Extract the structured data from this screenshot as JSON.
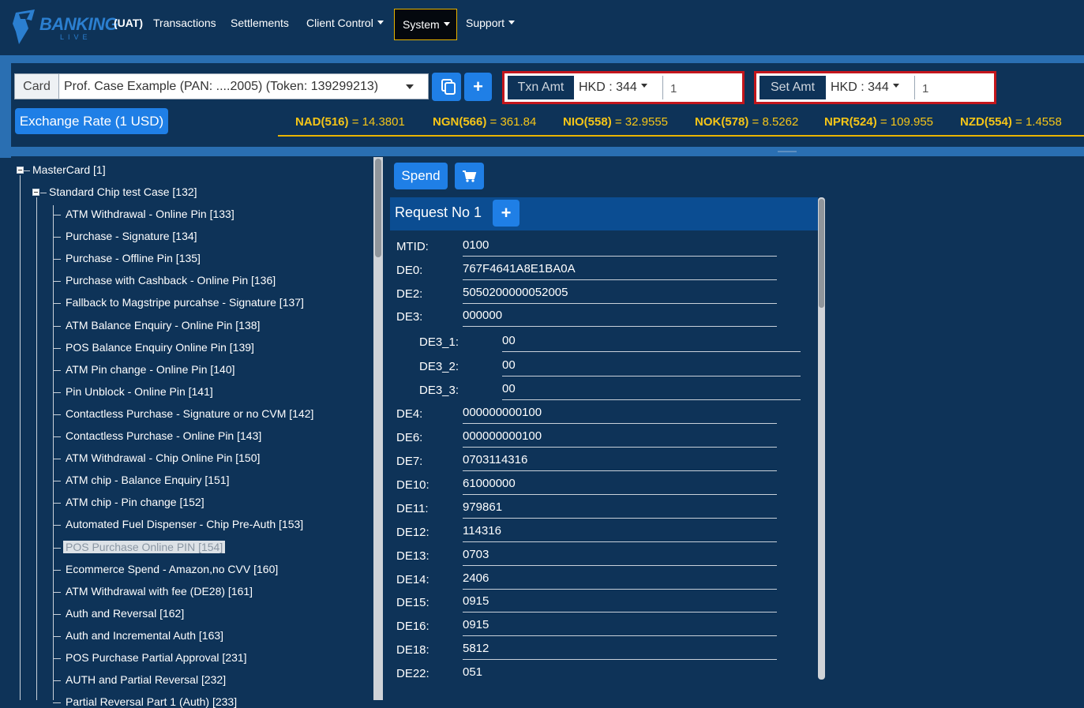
{
  "nav": {
    "logo_text": "BANKING",
    "logo_sub": "LIVE",
    "env_badge": "(UAT)",
    "items": [
      "Transactions",
      "Settlements",
      "Client Control",
      "System",
      "Support"
    ]
  },
  "card": {
    "label": "Card",
    "selected": "Prof. Case Example (PAN: ....2005) (Token: 139299213)"
  },
  "txn_amt": {
    "label": "Txn Amt",
    "currency": "HKD : 344",
    "value": "1"
  },
  "set_amt": {
    "label": "Set Amt",
    "currency": "HKD : 344",
    "value": "1"
  },
  "exchange_button": "Exchange Rate (1 USD)",
  "rates": [
    {
      "code": "NAD(516)",
      "value": "= 14.3801"
    },
    {
      "code": "NGN(566)",
      "value": "= 361.84"
    },
    {
      "code": "NIO(558)",
      "value": "= 32.9555"
    },
    {
      "code": "NOK(578)",
      "value": "= 8.5262"
    },
    {
      "code": "NPR(524)",
      "value": "= 109.955"
    },
    {
      "code": "NZD(554)",
      "value": "= 1.4558"
    }
  ],
  "tree": {
    "root": "MasterCard [1]",
    "group": "Standard Chip test Case [132]",
    "items": [
      "ATM Withdrawal - Online Pin [133]",
      "Purchase - Signature [134]",
      "Purchase - Offline Pin [135]",
      "Purchase with Cashback - Online Pin [136]",
      "Fallback to Magstripe purcahse - Signature [137]",
      "ATM Balance Enquiry - Online Pin [138]",
      "POS Balance Enquiry Online Pin [139]",
      "ATM Pin change - Online Pin [140]",
      "Pin Unblock - Online Pin [141]",
      "Contactless Purchase - Signature or no CVM [142]",
      "Contactless Purchase - Online Pin [143]",
      "ATM Withdrawal - Chip Online Pin [150]",
      "ATM chip - Balance Enquiry [151]",
      "ATM chip - Pin change [152]",
      "Automated Fuel Dispenser - Chip Pre-Auth [153]",
      "POS Purchase Online PIN [154]",
      "Ecommerce Spend - Amazon,no CVV [160]",
      "ATM Withdrawal with fee (DE28) [161]",
      "Auth and Reversal [162]",
      "Auth and Incremental Auth [163]",
      "POS Purchase Partial Approval [231]",
      "AUTH and Partial Reversal [232]",
      "Partial Reversal Part 1 (Auth) [233]"
    ],
    "selected_index": 15
  },
  "spend_button": "Spend",
  "request": {
    "title": "Request No 1",
    "fields": [
      {
        "label": "MTID:",
        "value": "0100",
        "indent": false
      },
      {
        "label": "DE0:",
        "value": "767F4641A8E1BA0A",
        "indent": false
      },
      {
        "label": "DE2:",
        "value": "5050200000052005",
        "indent": false
      },
      {
        "label": "DE3:",
        "value": "000000",
        "indent": false
      },
      {
        "label": "DE3_1:",
        "value": "00",
        "indent": true
      },
      {
        "label": "DE3_2:",
        "value": "00",
        "indent": true
      },
      {
        "label": "DE3_3:",
        "value": "00",
        "indent": true
      },
      {
        "label": "DE4:",
        "value": "000000000100",
        "indent": false
      },
      {
        "label": "DE6:",
        "value": "000000000100",
        "indent": false
      },
      {
        "label": "DE7:",
        "value": "0703114316",
        "indent": false
      },
      {
        "label": "DE10:",
        "value": "61000000",
        "indent": false
      },
      {
        "label": "DE11:",
        "value": "979861",
        "indent": false
      },
      {
        "label": "DE12:",
        "value": "114316",
        "indent": false
      },
      {
        "label": "DE13:",
        "value": "0703",
        "indent": false
      },
      {
        "label": "DE14:",
        "value": "2406",
        "indent": false
      },
      {
        "label": "DE15:",
        "value": "0915",
        "indent": false
      },
      {
        "label": "DE16:",
        "value": "0915",
        "indent": false
      },
      {
        "label": "DE18:",
        "value": "5812",
        "indent": false
      },
      {
        "label": "DE22:",
        "value": "051",
        "indent": false
      }
    ]
  },
  "colors": {
    "background": "#0e3358",
    "accent_blue": "#1f7fe6",
    "highlight_red": "#c3161c",
    "rate_yellow": "#f5c518"
  }
}
